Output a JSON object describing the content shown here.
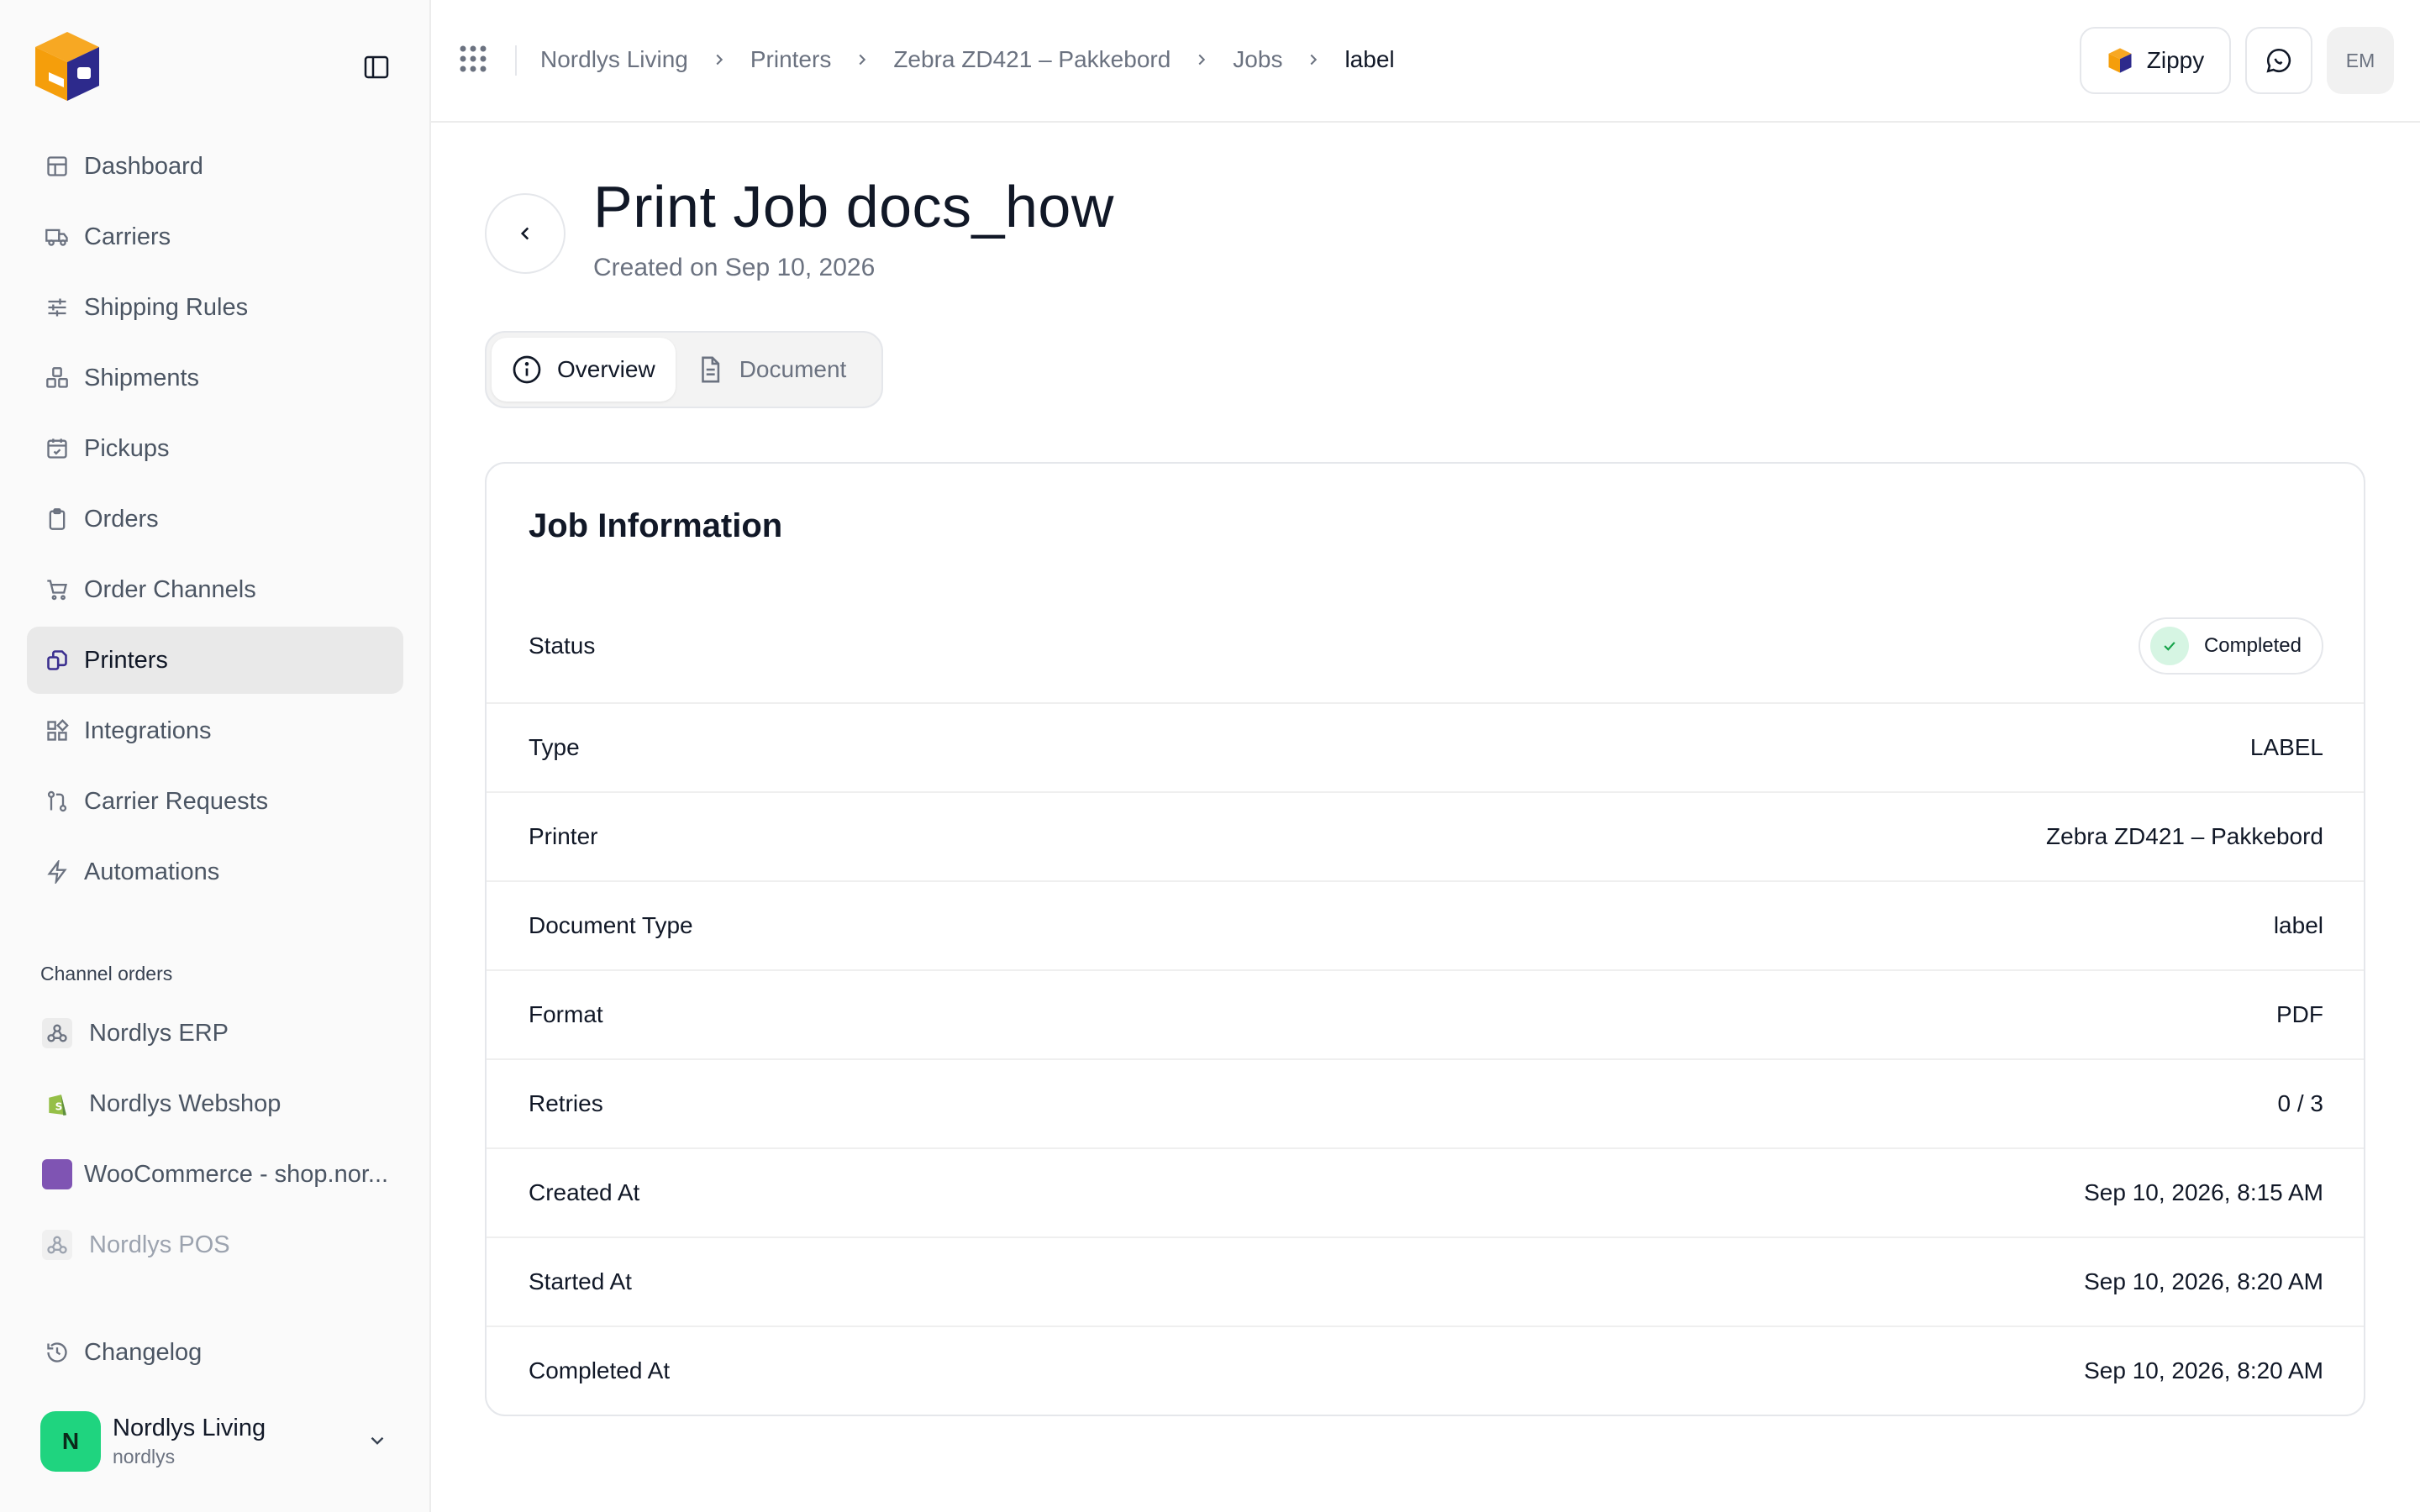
{
  "sidebar": {
    "nav": [
      {
        "label": "Dashboard",
        "icon": "dashboard-icon"
      },
      {
        "label": "Carriers",
        "icon": "truck-icon"
      },
      {
        "label": "Shipping Rules",
        "icon": "sliders-icon"
      },
      {
        "label": "Shipments",
        "icon": "boxes-icon"
      },
      {
        "label": "Pickups",
        "icon": "calendar-check-icon"
      },
      {
        "label": "Orders",
        "icon": "clipboard-icon"
      },
      {
        "label": "Order Channels",
        "icon": "cart-icon"
      },
      {
        "label": "Printers",
        "icon": "printer-icon",
        "active": true
      },
      {
        "label": "Integrations",
        "icon": "puzzle-icon"
      },
      {
        "label": "Carrier Requests",
        "icon": "git-pull-icon"
      },
      {
        "label": "Automations",
        "icon": "lightning-icon"
      }
    ],
    "channels_label": "Channel orders",
    "channels": [
      {
        "label": "Nordlys ERP",
        "icon": "webhook-icon"
      },
      {
        "label": "Nordlys Webshop",
        "icon": "shopify-icon"
      },
      {
        "label": "WooCommerce - shop.nor...",
        "icon": "woocommerce-icon"
      },
      {
        "label": "Nordlys POS",
        "icon": "webhook-icon"
      }
    ],
    "changelog": "Changelog",
    "account": {
      "initial": "N",
      "name": "Nordlys Living",
      "handle": "nordlys"
    }
  },
  "topbar": {
    "breadcrumbs": [
      "Nordlys Living",
      "Printers",
      "Zebra ZD421 – Pakkebord",
      "Jobs",
      "label"
    ],
    "zippy_label": "Zippy",
    "user_initials": "EM"
  },
  "page": {
    "title": "Print Job docs_how",
    "subtitle": "Created on Sep 10, 2026",
    "tabs": [
      {
        "label": "Overview",
        "icon": "info-icon",
        "active": true
      },
      {
        "label": "Document",
        "icon": "document-icon",
        "active": false
      }
    ]
  },
  "job": {
    "title": "Job Information",
    "status_label": "Status",
    "status_value": "Completed",
    "rows": [
      {
        "label": "Type",
        "value": "LABEL"
      },
      {
        "label": "Printer",
        "value": "Zebra ZD421 – Pakkebord"
      },
      {
        "label": "Document Type",
        "value": "label"
      },
      {
        "label": "Format",
        "value": "PDF"
      },
      {
        "label": "Retries",
        "value": "0 / 3"
      },
      {
        "label": "Created At",
        "value": "Sep 10, 2026, 8:15 AM"
      },
      {
        "label": "Started At",
        "value": "Sep 10, 2026, 8:20 AM"
      },
      {
        "label": "Completed At",
        "value": "Sep 10, 2026, 8:20 AM"
      }
    ]
  },
  "colors": {
    "accent_green": "#1fd47f",
    "brand_orange": "#f59e0b",
    "brand_indigo": "#3b2f8f"
  }
}
